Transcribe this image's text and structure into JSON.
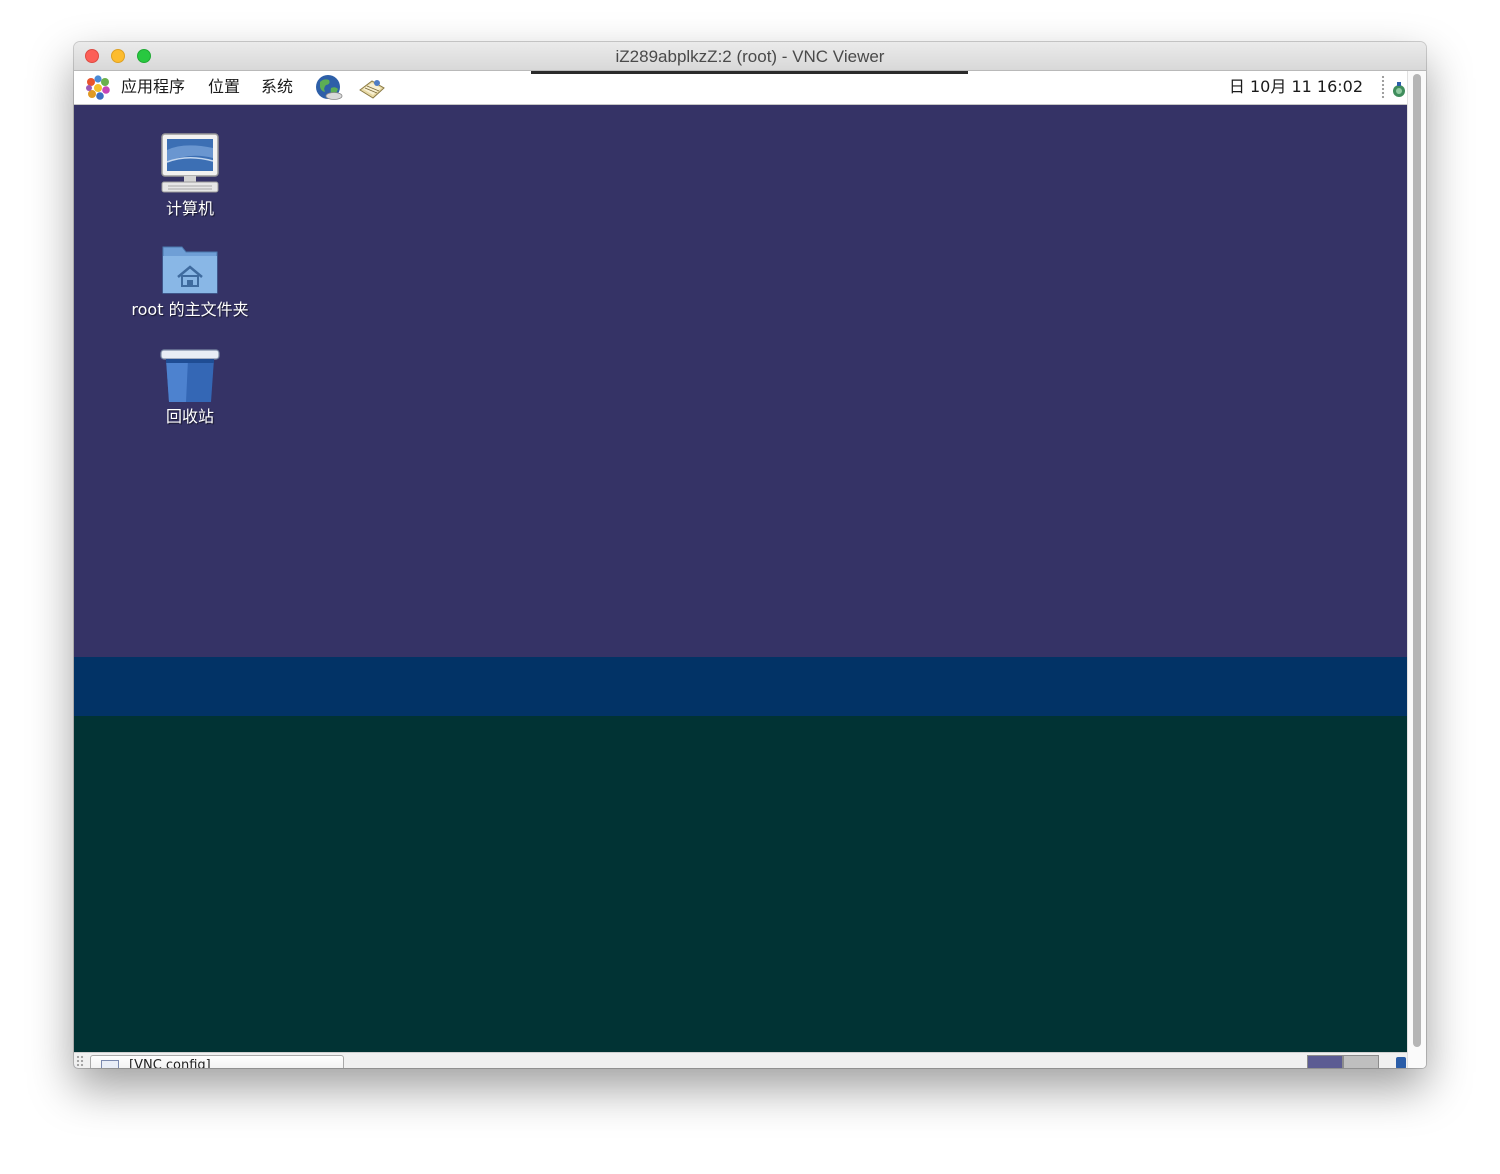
{
  "window": {
    "title": "iZ289abplkzZ:2 (root) - VNC Viewer"
  },
  "top_panel": {
    "menus": [
      "应用程序",
      "位置",
      "系统"
    ],
    "clock": "日 10月 11 16:02",
    "icons": [
      "gnome-foot-logo-icon",
      "web-browser-globe-icon",
      "mail-client-icon",
      "network-tray-icon"
    ]
  },
  "desktop": {
    "icons": [
      {
        "label": "计算机",
        "icon": "computer-icon"
      },
      {
        "label": "root 的主文件夹",
        "icon": "home-folder-icon"
      },
      {
        "label": "回收站",
        "icon": "trash-icon"
      }
    ]
  },
  "bottom_panel": {
    "task_label": "[VNC config]",
    "workspaces": 2
  },
  "colors": {
    "desktop_top": "#353366",
    "desktop_band": "#023366",
    "desktop_bottom": "#013334",
    "close": "#fc5f57",
    "minimize": "#fdbc2e",
    "maximize": "#28c840"
  }
}
